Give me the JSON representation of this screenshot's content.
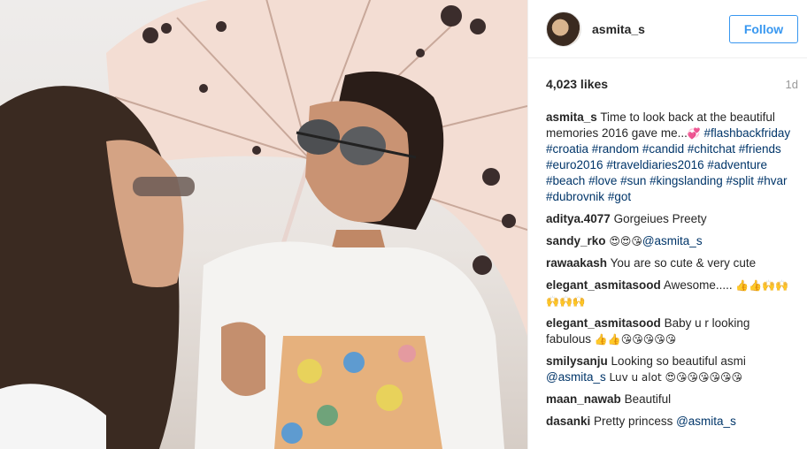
{
  "post": {
    "username": "asmita_s",
    "follow_label": "Follow",
    "likes": "4,023 likes",
    "age": "1d",
    "caption": {
      "user": "asmita_s",
      "text": "Time to look back at the beautiful memories 2016 gave me...",
      "emoji": "💞",
      "hashtags": [
        "#flashbackfriday",
        "#croatia",
        "#random",
        "#candid",
        "#chitchat",
        "#friends",
        "#euro2016",
        "#traveldiaries2016",
        "#adventure",
        "#beach",
        "#love",
        "#sun",
        "#kingslanding",
        "#split",
        "#hvar",
        "#dubrovnik",
        "#got"
      ]
    },
    "comments": [
      {
        "user": "aditya.4077",
        "text": "Gorgeiues Preety",
        "emoji": "",
        "mention": ""
      },
      {
        "user": "sandy_rko",
        "text": "",
        "emoji": "😍😍😘",
        "mention": "@asmita_s"
      },
      {
        "user": "rawaakash",
        "text": "You are so cute & very cute",
        "emoji": "",
        "mention": ""
      },
      {
        "user": "elegant_asmitasood",
        "text": "Awesome.....",
        "emoji": "👍👍🙌🙌🙌🙌🙌",
        "mention": ""
      },
      {
        "user": "elegant_asmitasood",
        "text": "Baby u r looking fabulous",
        "emoji": "👍👍😘😘😘😘😘",
        "mention": ""
      },
      {
        "user": "smilysanju",
        "text": "Looking so beautiful asmi",
        "emoji": "Luv u alot 😍😘😘😘😘😘😘",
        "mention": "@asmita_s"
      },
      {
        "user": "maan_nawab",
        "text": "Beautiful",
        "emoji": "",
        "mention": ""
      },
      {
        "user": "dasanki",
        "text": "Pretty princess",
        "emoji": "",
        "mention": "@asmita_s"
      }
    ]
  }
}
